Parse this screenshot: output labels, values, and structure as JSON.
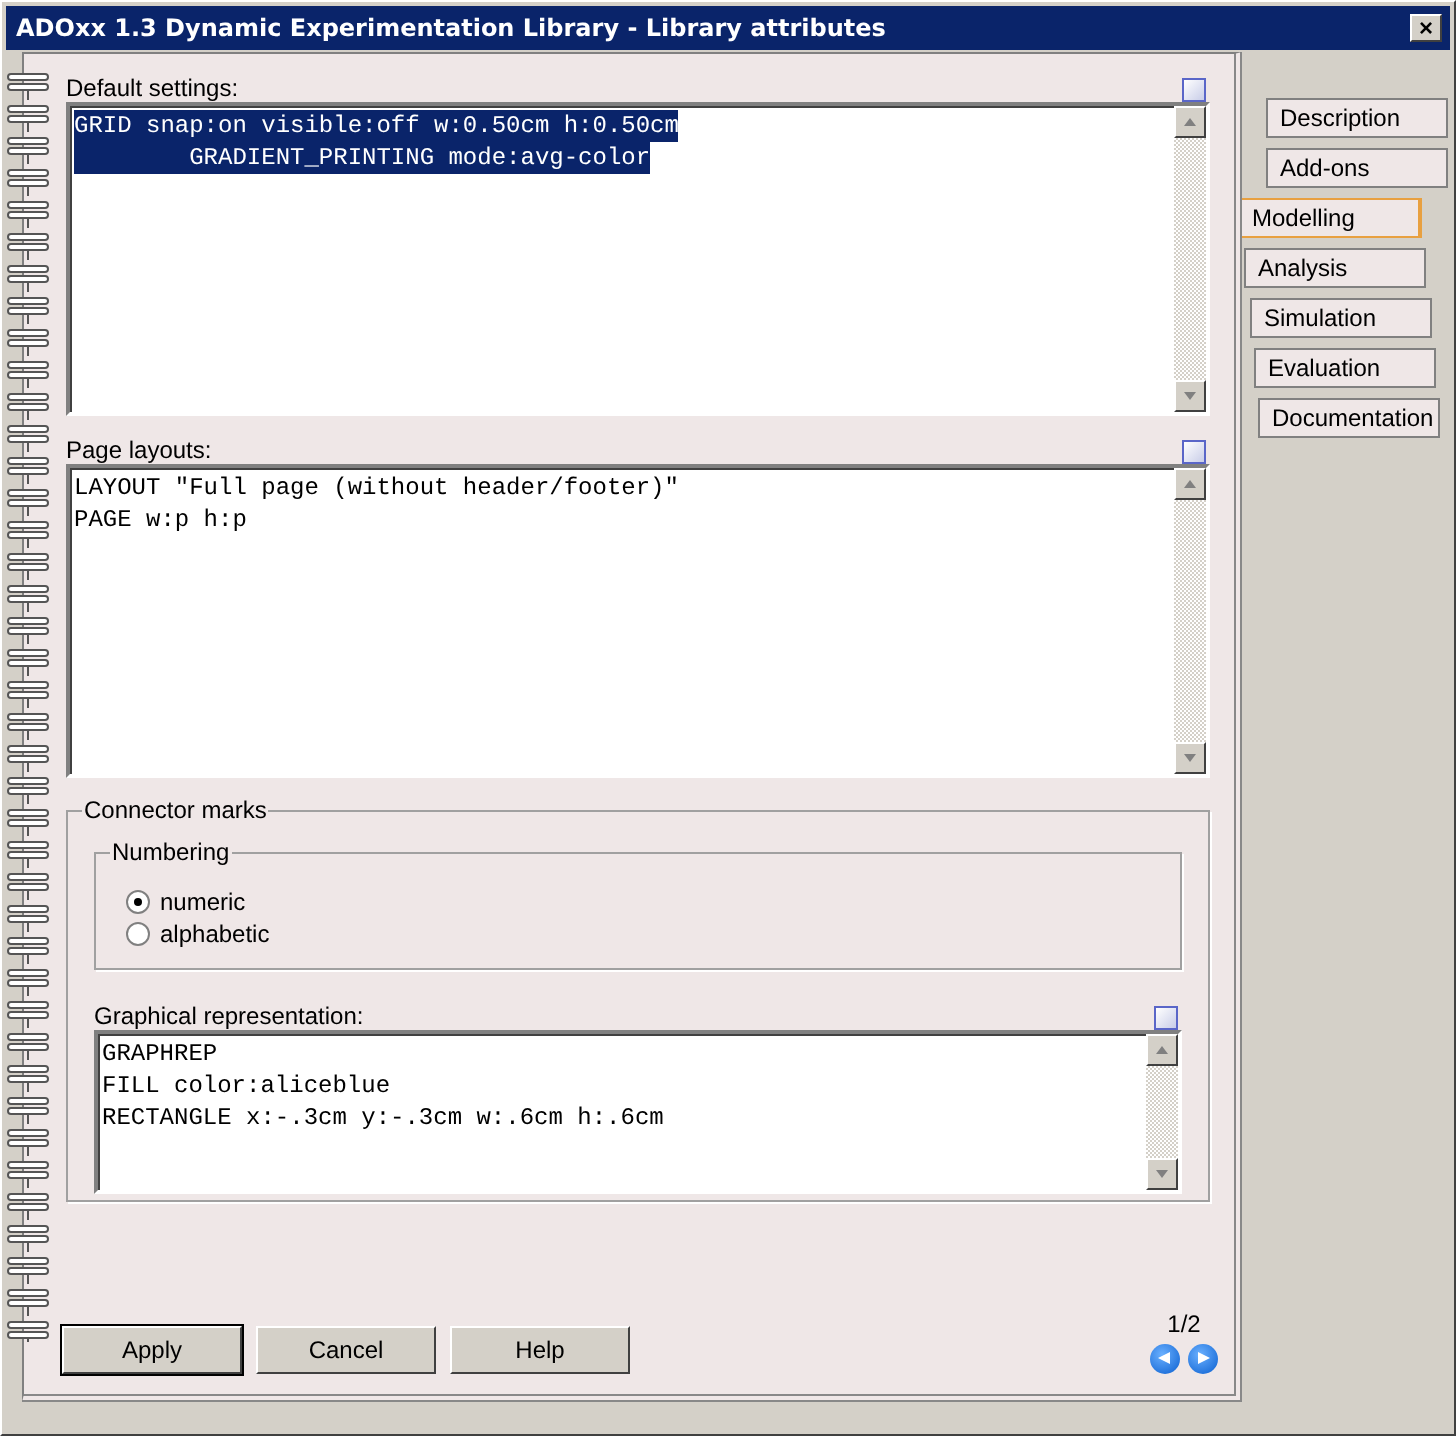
{
  "window": {
    "title": "ADOxx 1.3 Dynamic Experimentation Library - Library attributes",
    "close": "×"
  },
  "default_settings": {
    "label": "Default settings:",
    "selected": true,
    "lines": [
      "GRID snap:on visible:off w:0.50cm h:0.50cm",
      "        GRADIENT_PRINTING mode:avg-color"
    ]
  },
  "page_layouts": {
    "label": "Page layouts:",
    "selected": false,
    "lines": [
      "LAYOUT \"Full page (without header/footer)\"",
      "PAGE w:p h:p"
    ]
  },
  "connector_marks": {
    "title": "Connector marks",
    "numbering": {
      "title": "Numbering",
      "options": [
        {
          "label": "numeric",
          "selected": true
        },
        {
          "label": "alphabetic",
          "selected": false
        }
      ]
    },
    "graphical_representation": {
      "label": "Graphical representation:",
      "selected": false,
      "lines": [
        "GRAPHREP",
        "FILL color:aliceblue",
        "RECTANGLE x:-.3cm y:-.3cm w:.6cm h:.6cm"
      ]
    }
  },
  "buttons": [
    {
      "label": "Apply",
      "default": true
    },
    {
      "label": "Cancel",
      "default": false
    },
    {
      "label": "Help",
      "default": false
    }
  ],
  "pager": {
    "page": "1/2"
  },
  "tabs": [
    {
      "label": "Description",
      "selected": false
    },
    {
      "label": "Add-ons",
      "selected": false
    },
    {
      "label": "Modelling",
      "selected": true
    },
    {
      "label": "Analysis",
      "selected": false
    },
    {
      "label": "Simulation",
      "selected": false
    },
    {
      "label": "Evaluation",
      "selected": false
    },
    {
      "label": "Documentation",
      "selected": false
    }
  ]
}
